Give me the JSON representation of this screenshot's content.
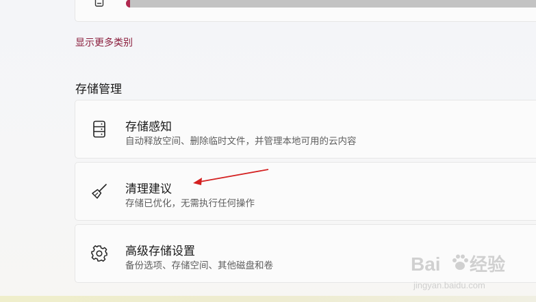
{
  "storage_usage": {
    "fill_fraction": 0.01
  },
  "show_more_label": "显示更多类别",
  "section": {
    "title": "存储管理"
  },
  "items": [
    {
      "title": "存储感知",
      "desc": "自动释放空间、删除临时文件，并管理本地可用的云内容",
      "icon": "storage-drive-icon"
    },
    {
      "title": "清理建议",
      "desc": "存储已优化，无需执行任何操作",
      "icon": "broom-icon"
    },
    {
      "title": "高级存储设置",
      "desc": "备份选项、存储空间、其他磁盘和卷",
      "icon": "gear-icon"
    }
  ],
  "watermark": {
    "brand": "Baidu",
    "cn": "经验",
    "url": "jingyan.baidu.com"
  },
  "colors": {
    "accent": "#8a1d3c",
    "usage_fill": "#b0284f",
    "usage_track": "#c3c3c3",
    "annotation_arrow": "#d42020"
  }
}
